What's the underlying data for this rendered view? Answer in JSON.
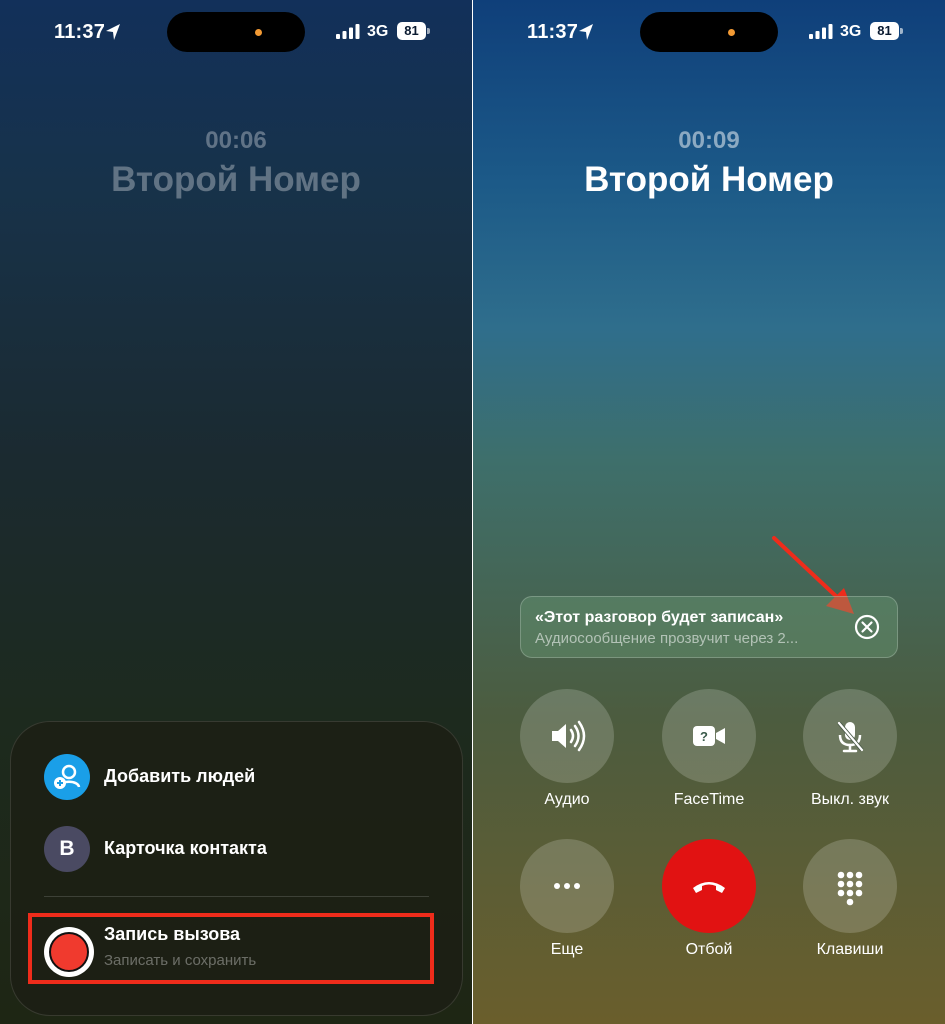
{
  "status_bar": {
    "time": "11:37",
    "network": "3G",
    "battery": "81"
  },
  "left": {
    "call_timer": "00:06",
    "caller_name": "Второй Номер",
    "menu": {
      "add_people": "Добавить людей",
      "contact_card": "Карточка контакта",
      "contact_initial": "В",
      "record_call": "Запись вызова",
      "record_call_sub": "Записать и сохранить"
    }
  },
  "right": {
    "call_timer": "00:09",
    "caller_name": "Второй Номер",
    "banner": {
      "title": "«Этот разговор будет записан»",
      "subtitle": "Аудиосообщение прозвучит через 2..."
    },
    "controls": {
      "audio": "Аудио",
      "facetime": "FaceTime",
      "mute": "Выкл. звук",
      "more": "Еще",
      "end": "Отбой",
      "keypad": "Клавиши"
    }
  },
  "colors": {
    "end_call": "#e11212",
    "record": "#f03a2e",
    "highlight": "#ee2c1b",
    "add_people": "#1a9fe8"
  }
}
